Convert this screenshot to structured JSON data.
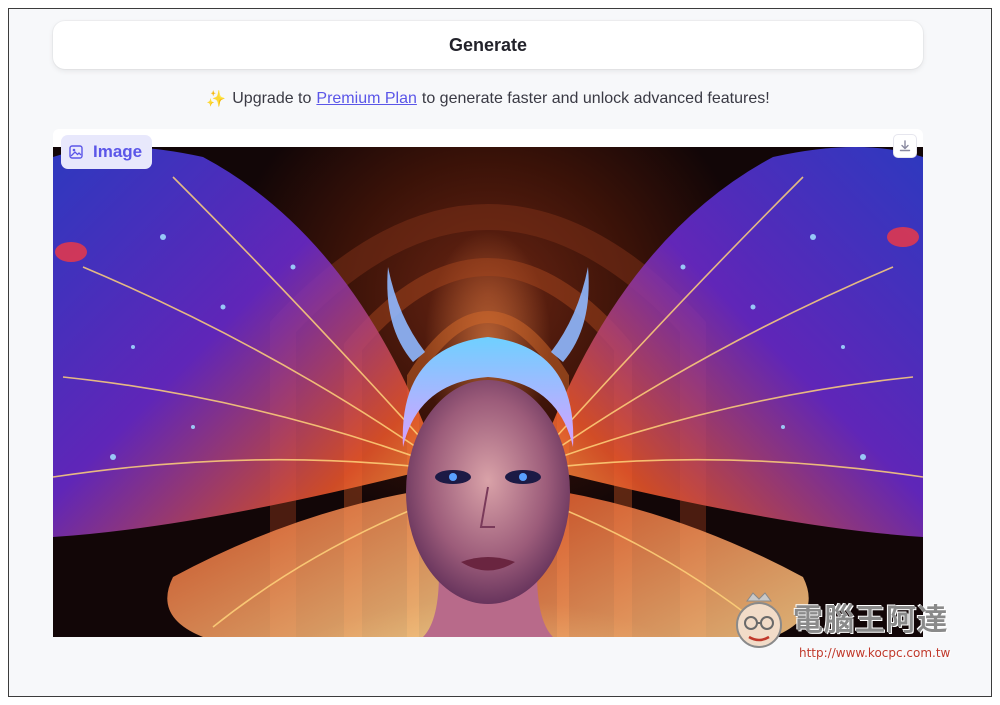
{
  "generate": {
    "label": "Generate"
  },
  "upgrade": {
    "sparkle": "✨",
    "prefix": "Upgrade to",
    "link": "Premium Plan",
    "suffix": "to generate faster and unlock advanced features!",
    "link_color": "#5b56e8"
  },
  "result": {
    "tag_label": "Image",
    "tag_icon": "image-icon",
    "download_icon": "download-icon"
  },
  "watermark": {
    "brand": "電腦王阿達",
    "url": "http://www.kocpc.com.tw"
  },
  "colors": {
    "accent": "#5b56e8",
    "tag_bg": "#e8e8fc",
    "page_bg": "#f7f8fa"
  }
}
